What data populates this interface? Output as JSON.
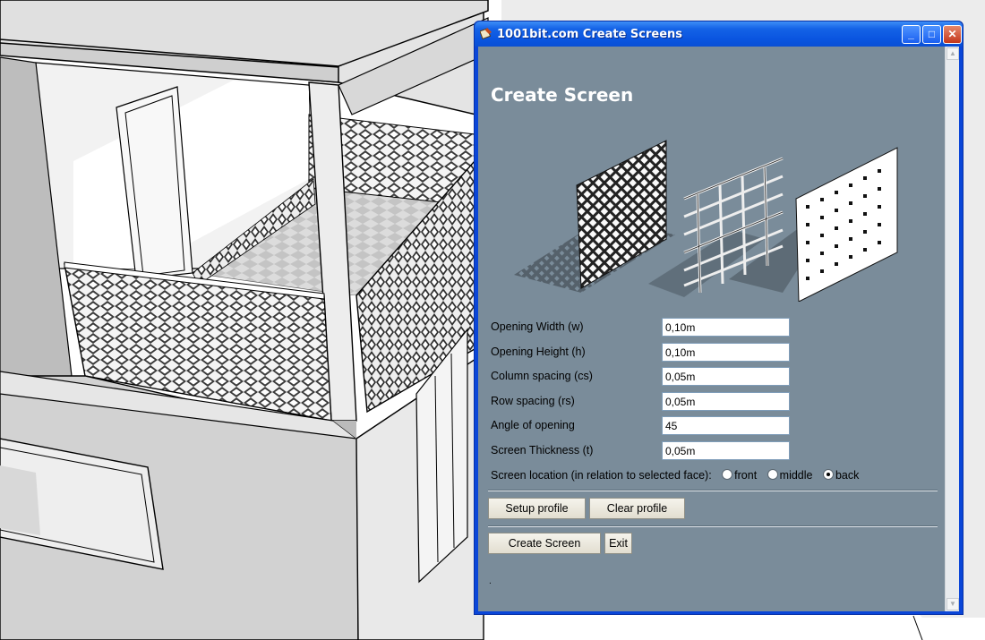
{
  "window": {
    "title": "1001bit.com Create Screens",
    "minimize_glyph": "_",
    "maximize_glyph": "□",
    "close_glyph": "✕"
  },
  "dialog": {
    "heading": "Create Screen",
    "fields": [
      {
        "label": "Opening Width (w)",
        "value": "0,10m"
      },
      {
        "label": "Opening Height (h)",
        "value": "0,10m"
      },
      {
        "label": "Column spacing (cs)",
        "value": "0,05m"
      },
      {
        "label": "Row spacing (rs)",
        "value": "0,05m"
      },
      {
        "label": "Angle of opening",
        "value": "45"
      },
      {
        "label": "Screen Thickness (t)",
        "value": "0,05m"
      }
    ],
    "location": {
      "label": "Screen location (in relation to selected face):",
      "options": [
        "front",
        "middle",
        "back"
      ],
      "selected": "back"
    },
    "buttons": {
      "setup_profile": "Setup profile",
      "clear_profile": "Clear profile",
      "create_screen": "Create Screen",
      "exit": "Exit"
    },
    "status_dot": "."
  },
  "colors": {
    "dialog_bg": "#7a8c9a",
    "title_blue": "#0a55e0",
    "close_red": "#c4371c"
  },
  "icons": [
    "app-icon",
    "minimize-icon",
    "maximize-icon",
    "close-icon",
    "scroll-up-icon",
    "scroll-down-icon"
  ]
}
